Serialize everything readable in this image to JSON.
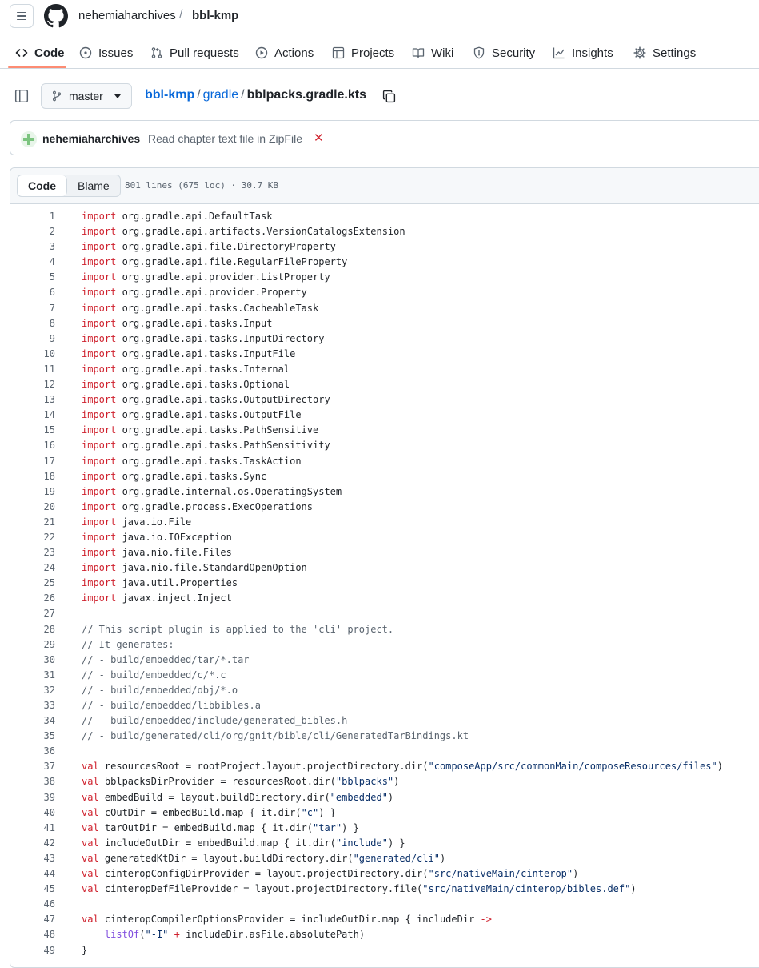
{
  "header": {
    "owner": "nehemiaharchives",
    "separator": "/",
    "repo": "bbl-kmp"
  },
  "nav": {
    "tabs": [
      {
        "label": "Code",
        "icon": "code-icon",
        "active": true
      },
      {
        "label": "Issues",
        "icon": "issue-opened-icon"
      },
      {
        "label": "Pull requests",
        "icon": "git-pull-request-icon"
      },
      {
        "label": "Actions",
        "icon": "play-icon"
      },
      {
        "label": "Projects",
        "icon": "table-icon"
      },
      {
        "label": "Wiki",
        "icon": "book-icon"
      },
      {
        "label": "Security",
        "icon": "shield-icon"
      },
      {
        "label": "Insights",
        "icon": "graph-icon"
      },
      {
        "label": "Settings",
        "icon": "gear-icon"
      }
    ]
  },
  "path": {
    "branch": "master",
    "root": "bbl-kmp",
    "dir": "gradle",
    "file": "bblpacks.gradle.kts",
    "sep": "/"
  },
  "commit": {
    "author": "nehemiaharchives",
    "message": "Read chapter text file in ZipFile",
    "status_glyph": "✕",
    "status_color": "#d1242f"
  },
  "file": {
    "view_code": "Code",
    "view_blame": "Blame",
    "info": "801 lines (675 loc) · 30.7 KB"
  },
  "code_lines": [
    "import org.gradle.api.DefaultTask",
    "import org.gradle.api.artifacts.VersionCatalogsExtension",
    "import org.gradle.api.file.DirectoryProperty",
    "import org.gradle.api.file.RegularFileProperty",
    "import org.gradle.api.provider.ListProperty",
    "import org.gradle.api.provider.Property",
    "import org.gradle.api.tasks.CacheableTask",
    "import org.gradle.api.tasks.Input",
    "import org.gradle.api.tasks.InputDirectory",
    "import org.gradle.api.tasks.InputFile",
    "import org.gradle.api.tasks.Internal",
    "import org.gradle.api.tasks.Optional",
    "import org.gradle.api.tasks.OutputDirectory",
    "import org.gradle.api.tasks.OutputFile",
    "import org.gradle.api.tasks.PathSensitive",
    "import org.gradle.api.tasks.PathSensitivity",
    "import org.gradle.api.tasks.TaskAction",
    "import org.gradle.api.tasks.Sync",
    "import org.gradle.internal.os.OperatingSystem",
    "import org.gradle.process.ExecOperations",
    "import java.io.File",
    "import java.io.IOException",
    "import java.nio.file.Files",
    "import java.nio.file.StandardOpenOption",
    "import java.util.Properties",
    "import javax.inject.Inject",
    "",
    "// This script plugin is applied to the 'cli' project.",
    "// It generates:",
    "// - build/embedded/tar/*.tar",
    "// - build/embedded/c/*.c",
    "// - build/embedded/obj/*.o",
    "// - build/embedded/libbibles.a",
    "// - build/embedded/include/generated_bibles.h",
    "// - build/generated/cli/org/gnit/bible/cli/GeneratedTarBindings.kt",
    "",
    "val resourcesRoot = rootProject.layout.projectDirectory.dir(\"composeApp/src/commonMain/composeResources/files\")",
    "val bblpacksDirProvider = resourcesRoot.dir(\"bblpacks\")",
    "val embedBuild = layout.buildDirectory.dir(\"embedded\")",
    "val cOutDir = embedBuild.map { it.dir(\"c\") }",
    "val tarOutDir = embedBuild.map { it.dir(\"tar\") }",
    "val includeOutDir = embedBuild.map { it.dir(\"include\") }",
    "val generatedKtDir = layout.buildDirectory.dir(\"generated/cli\")",
    "val cinteropConfigDirProvider = layout.projectDirectory.dir(\"src/nativeMain/cinterop\")",
    "val cinteropDefFileProvider = layout.projectDirectory.file(\"src/nativeMain/cinterop/bibles.def\")",
    "",
    "val cinteropCompilerOptionsProvider = includeOutDir.map { includeDir ->",
    "    listOf(\"-I\" + includeDir.asFile.absolutePath)",
    "}"
  ]
}
